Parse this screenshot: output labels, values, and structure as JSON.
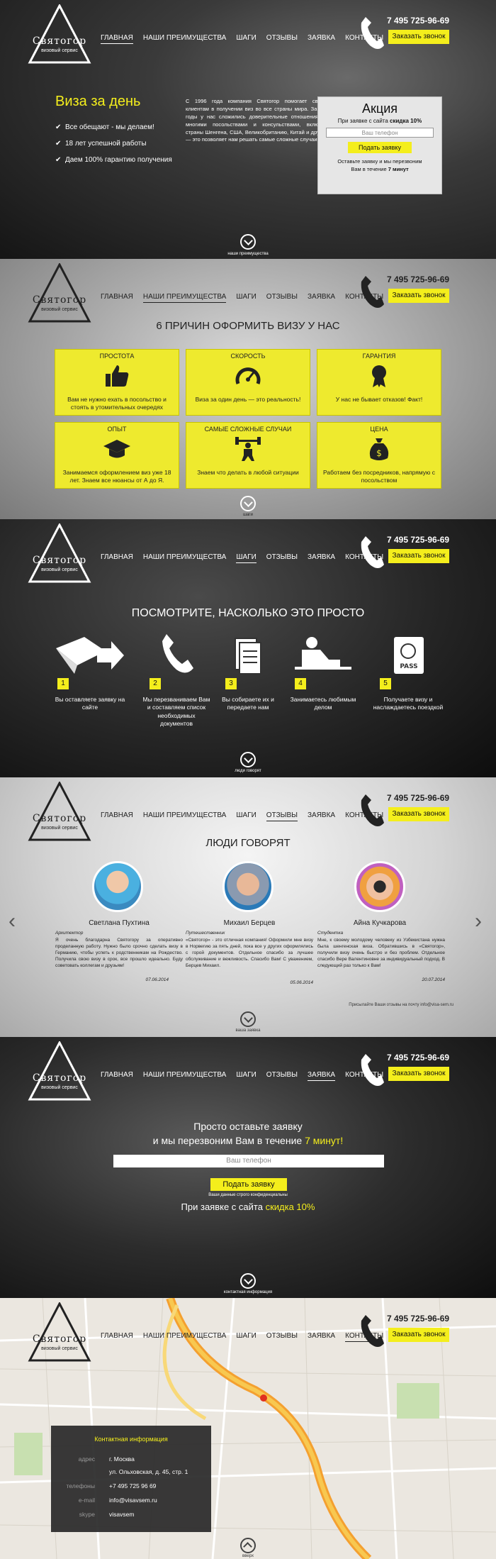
{
  "header": {
    "logo_title": "Святогор",
    "logo_sub": "визовый сервис",
    "nav": [
      "ГЛАВНАЯ",
      "НАШИ ПРЕИМУЩЕСТВА",
      "ШАГИ",
      "ОТЗЫВЫ",
      "ЗАЯВКА",
      "КОНТАКТЫ"
    ],
    "phone": "7 495 725-96-69",
    "call_label": "Заказать звонок"
  },
  "hero": {
    "title": "Виза за день",
    "points": [
      "Все обещают - мы делаем!",
      "18 лет успешной работы",
      "Даем 100% гарантию получения"
    ],
    "about": "С 1996 года компания Святогор помогает своим клиентам в получении виз во все страны мира. За эти годы у нас сложились доверительные отношения со многими посольствами и консульствами, включая страны Шенгена, США, Великобританию, Китай и другие — это позволяет нам решать самые сложные случаи.",
    "promo_title": "Акция",
    "promo_line1": "При заявке с сайта",
    "promo_discount": "скидка 10%",
    "phone_placeholder": "Ваш телефон",
    "submit": "Подать заявку",
    "callback_line": "Оставьте заявку и мы перезвоним",
    "callback_line2": "Вам в течение",
    "callback_time": "7 минут",
    "next": "наши преимущества"
  },
  "advantages": {
    "title": "6 ПРИЧИН ОФОРМИТЬ ВИЗУ У НАС",
    "cards": [
      {
        "title": "ПРОСТОТА",
        "text": "Вам не нужно ехать в посольство и стоять в утомительных очередях",
        "icon": "thumbs-up-icon"
      },
      {
        "title": "СКОРОСТЬ",
        "text": "Виза за один день — это реальность!",
        "icon": "speedometer-icon"
      },
      {
        "title": "ГАРАНТИЯ",
        "text": "У нас не бывает отказов! Факт!",
        "icon": "award-icon"
      },
      {
        "title": "ОПЫТ",
        "text": "Занимаемся оформлением виз уже 18 лет. Знаем все нюансы от А до Я.",
        "icon": "graduation-cap-icon"
      },
      {
        "title": "САМЫЕ СЛОЖНЫЕ СЛУЧАИ",
        "text": "Знаем что делать в любой ситуации",
        "icon": "weightlifter-icon"
      },
      {
        "title": "ЦЕНА",
        "text": "Работаем без посредников, напрямую с посольством",
        "icon": "money-bag-icon"
      }
    ],
    "next": "шаги"
  },
  "steps": {
    "title": "ПОСМОТРИТЕ, НАСКОЛЬКО ЭТО ПРОСТО",
    "items": [
      {
        "n": "1",
        "text": "Вы оставляете заявку на сайте"
      },
      {
        "n": "2",
        "text": "Мы перезваниваем Вам и составляем список необходимых документов"
      },
      {
        "n": "3",
        "text": "Вы собираете их и передаете нам"
      },
      {
        "n": "4",
        "text": "Занимаетесь любимым делом"
      },
      {
        "n": "5",
        "text": "Получаете визу и наслаждаетесь поездкой"
      }
    ],
    "next": "люди говорят"
  },
  "reviews": {
    "title": "ЛЮДИ ГОВОРЯТ",
    "items": [
      {
        "name": "Светлана Пухтина",
        "role": "Архитектор",
        "text": "Я очень благодарна Святогору за оперативно проделанную работу. Нужно было срочно сделать визу в Германию, чтобы успеть к родственникам на Рождество. Получила свою визу в срок, все прошло идеально. Буду советовать коллегам и друзьям!",
        "date": "07.06.2014"
      },
      {
        "name": "Михаил Берцев",
        "role": "Путешественник",
        "text": "«Святогор» - это отличная компания! Оформили мне визу в Норвегию за пять дней, пока все у других оформлялись с горой документов. Отдельное спасибо за лучшее обслуживание и вежливость. Спасибо Вам! С уважением, Берцев Михаил.",
        "date": "05.06.2014"
      },
      {
        "name": "Айна Кучкарова",
        "role": "Студентка",
        "text": "Мне, к своему молодому человеку из Узбекистана нужна была шенгенская виза. Обратившись в «Святогор», получили визу очень быстро и без проблем. Отдельное спасибо Вере Валентиновне за индивидуальный подход. В следующий раз только к Вам!",
        "date": "20.07.2014"
      }
    ],
    "send_text": "Присылайте Ваши отзывы на почту info@visa-sem.ru",
    "next": "ваша заявка"
  },
  "application": {
    "line1": "Просто оставьте заявку",
    "line2": "и мы перезвоним Вам в течение",
    "time": "7 минут!",
    "placeholder": "Ваш телефон",
    "submit": "Подать заявку",
    "privacy": "Ваши данные строго конфиденциальны",
    "discount_pre": "При заявке с сайта",
    "discount": "скидка 10%",
    "next": "контактная информация"
  },
  "contacts": {
    "title": "Контактная информация",
    "rows": [
      {
        "label": "адрес",
        "value": "г. Москва"
      },
      {
        "label": "",
        "value": "ул. Ольховская, д. 45, стр. 1"
      },
      {
        "label": "телефоны",
        "value": "+7 495 725 96 69"
      },
      {
        "label": "e-mail",
        "value": "info@visavsem.ru"
      },
      {
        "label": "skype",
        "value": "visavsem"
      }
    ],
    "next": "вверх"
  },
  "colors": {
    "accent": "#f4ee1c"
  }
}
